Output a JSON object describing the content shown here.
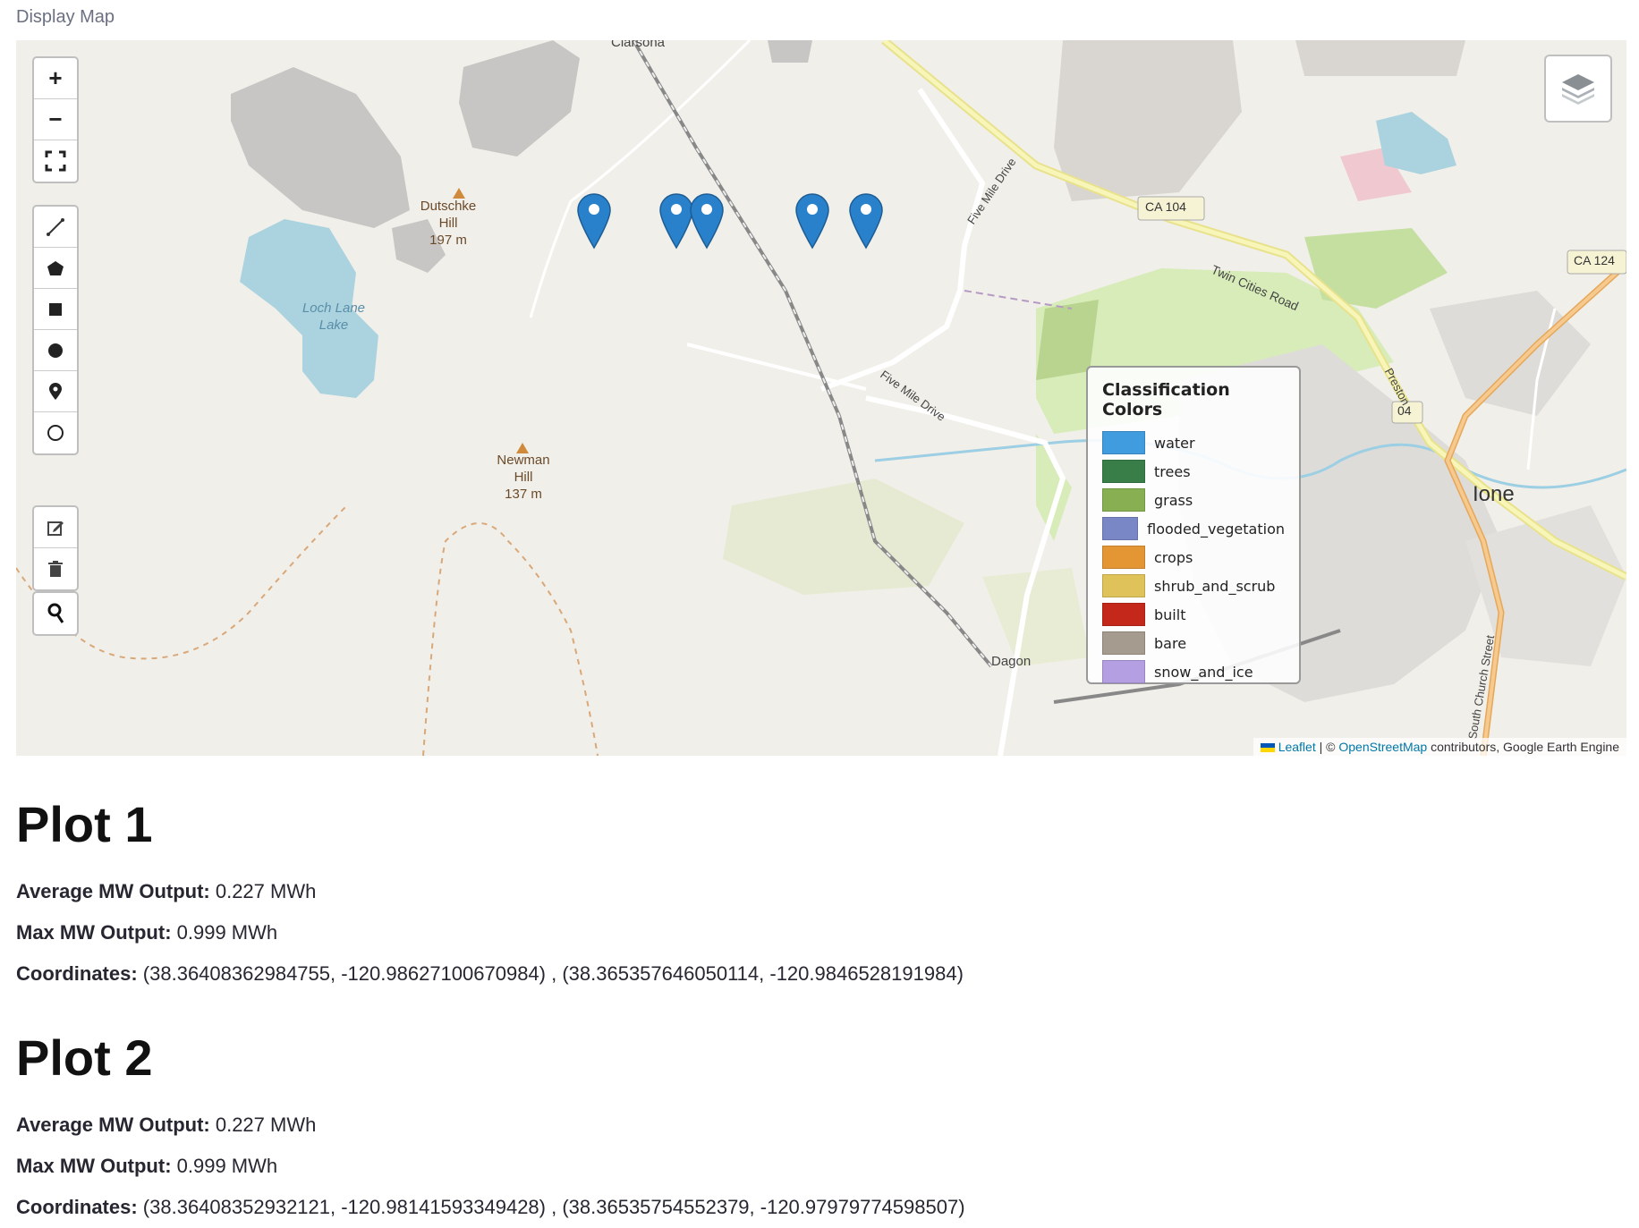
{
  "map_label": "Display Map",
  "map": {
    "controls": {
      "zoom_in": "+",
      "zoom_out": "−"
    },
    "place_labels": {
      "clarsona": "Clarsona",
      "dutschke": [
        "Dutschke",
        "Hill",
        "197 m"
      ],
      "loch_lane": [
        "Loch Lane",
        "Lake"
      ],
      "newman": [
        "Newman",
        "Hill",
        "137 m"
      ],
      "dagon": "Dagon",
      "ione": "Ione",
      "ca104": "CA 104",
      "ca124": "CA 124",
      "r04": "04",
      "twin_cities": "Twin Cities Road",
      "five_mile_1": "Five Mile Drive",
      "five_mile_2": "Five Mile Drive",
      "preston": "Preston",
      "south_church": "South Church Street"
    },
    "legend": {
      "title": "Classification Colors",
      "items": [
        {
          "label": "water",
          "color": "#419bdf"
        },
        {
          "label": "trees",
          "color": "#397d49"
        },
        {
          "label": "grass",
          "color": "#88b053"
        },
        {
          "label": "flooded_vegetation",
          "color": "#7a87c6"
        },
        {
          "label": "crops",
          "color": "#e49635"
        },
        {
          "label": "shrub_and_scrub",
          "color": "#dfc35a"
        },
        {
          "label": "built",
          "color": "#c4281b"
        },
        {
          "label": "bare",
          "color": "#a59b8f"
        },
        {
          "label": "snow_and_ice",
          "color": "#b39fe1"
        }
      ]
    },
    "attribution": {
      "leaflet": "Leaflet",
      "separator": " | © ",
      "osm": "OpenStreetMap",
      "rest": " contributors, Google Earth Engine"
    },
    "marker_color": "#2a81cb"
  },
  "plots": [
    {
      "title": "Plot 1",
      "avg_label": "Average MW Output:",
      "avg_value": " 0.227 MWh",
      "max_label": "Max MW Output:",
      "max_value": " 0.999 MWh",
      "coord_label": "Coordinates:",
      "coord_value": " (38.36408362984755, -120.98627100670984) , (38.365357646050114, -120.9846528191984)"
    },
    {
      "title": "Plot 2",
      "avg_label": "Average MW Output:",
      "avg_value": " 0.227 MWh",
      "max_label": "Max MW Output:",
      "max_value": " 0.999 MWh",
      "coord_label": "Coordinates:",
      "coord_value": " (38.36408352932121, -120.98141593349428) , (38.36535754552379, -120.97979774598507)"
    }
  ]
}
